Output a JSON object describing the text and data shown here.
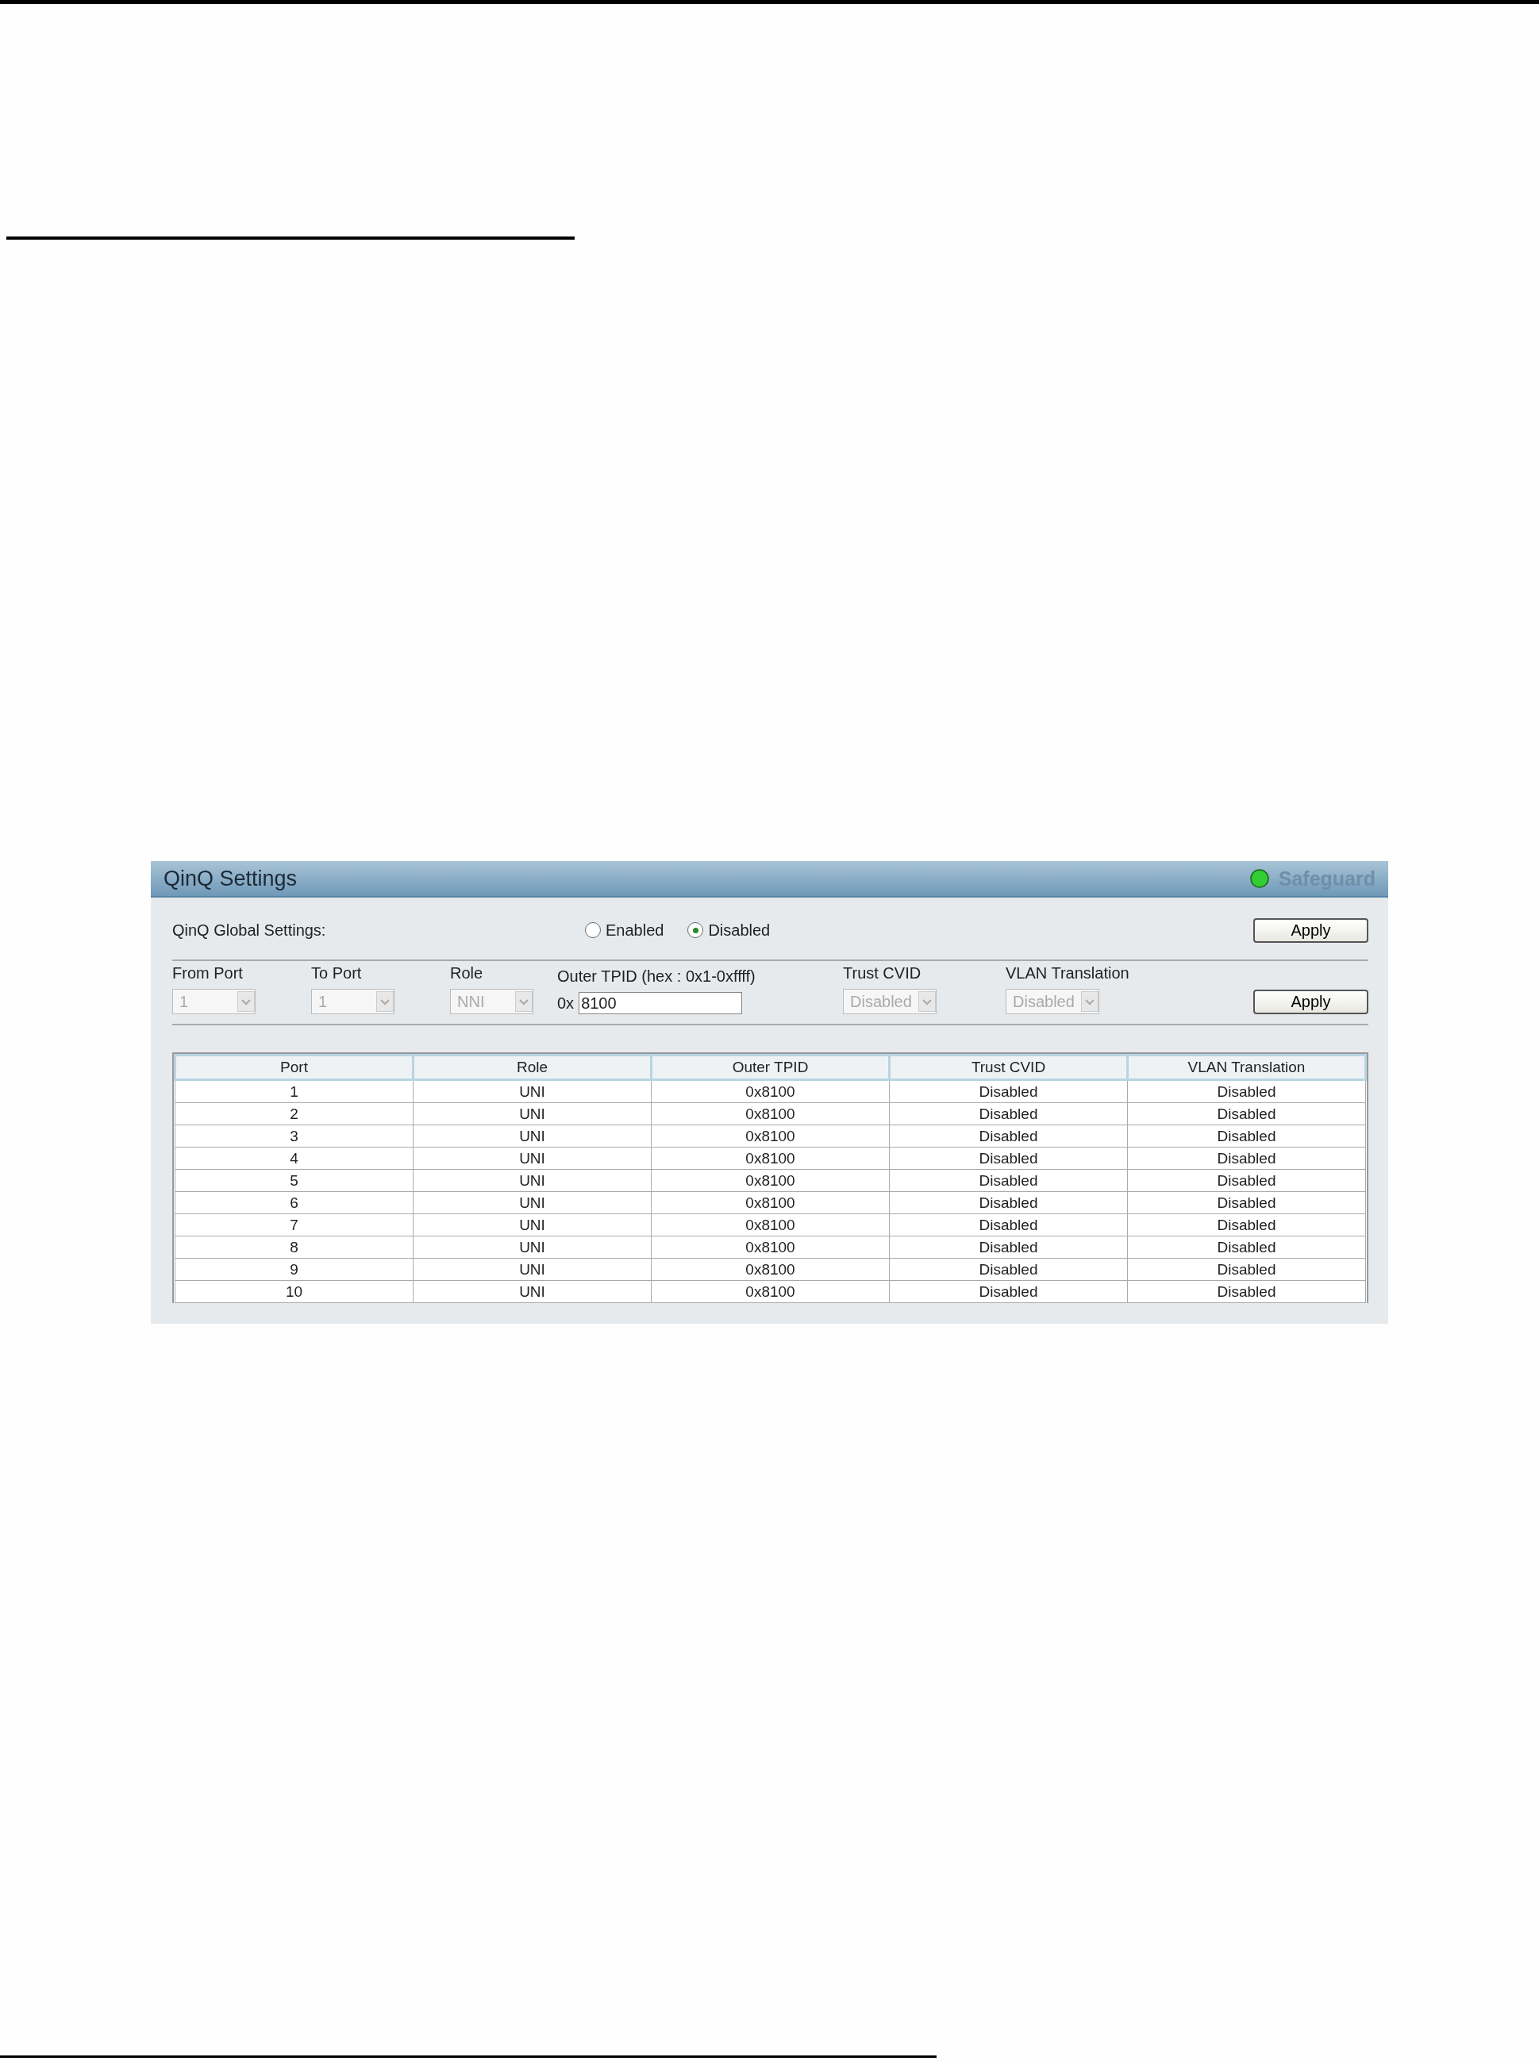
{
  "panel": {
    "title": "QinQ Settings",
    "status": {
      "label": "Safeguard",
      "color": "#33cc33"
    }
  },
  "global_settings": {
    "label": "QinQ Global Settings:",
    "options": [
      {
        "label": "Enabled",
        "selected": false
      },
      {
        "label": "Disabled",
        "selected": true
      }
    ],
    "button": "Apply"
  },
  "port_settings": {
    "fields": [
      {
        "label": "From Port",
        "kind": "select",
        "value": "1",
        "disabled": true
      },
      {
        "label": "To Port",
        "kind": "select",
        "value": "1",
        "disabled": true
      },
      {
        "label": "Role",
        "kind": "select",
        "value": "NNI",
        "disabled": true
      },
      {
        "label": "Outer TPID (hex : 0x1-0xffff)",
        "kind": "text",
        "prefix": "0x",
        "value": "8100",
        "disabled": false
      },
      {
        "label": "Trust CVID",
        "kind": "select",
        "value": "Disabled",
        "disabled": true
      },
      {
        "label": "VLAN Translation",
        "kind": "select",
        "value": "Disabled",
        "disabled": true
      }
    ],
    "button": "Apply"
  },
  "table": {
    "columns": [
      "Port",
      "Role",
      "Outer TPID",
      "Trust CVID",
      "VLAN Translation"
    ],
    "rows": [
      [
        "1",
        "UNI",
        "0x8100",
        "Disabled",
        "Disabled"
      ],
      [
        "2",
        "UNI",
        "0x8100",
        "Disabled",
        "Disabled"
      ],
      [
        "3",
        "UNI",
        "0x8100",
        "Disabled",
        "Disabled"
      ],
      [
        "4",
        "UNI",
        "0x8100",
        "Disabled",
        "Disabled"
      ],
      [
        "5",
        "UNI",
        "0x8100",
        "Disabled",
        "Disabled"
      ],
      [
        "6",
        "UNI",
        "0x8100",
        "Disabled",
        "Disabled"
      ],
      [
        "7",
        "UNI",
        "0x8100",
        "Disabled",
        "Disabled"
      ],
      [
        "8",
        "UNI",
        "0x8100",
        "Disabled",
        "Disabled"
      ],
      [
        "9",
        "UNI",
        "0x8100",
        "Disabled",
        "Disabled"
      ],
      [
        "10",
        "UNI",
        "0x8100",
        "Disabled",
        "Disabled"
      ]
    ]
  }
}
